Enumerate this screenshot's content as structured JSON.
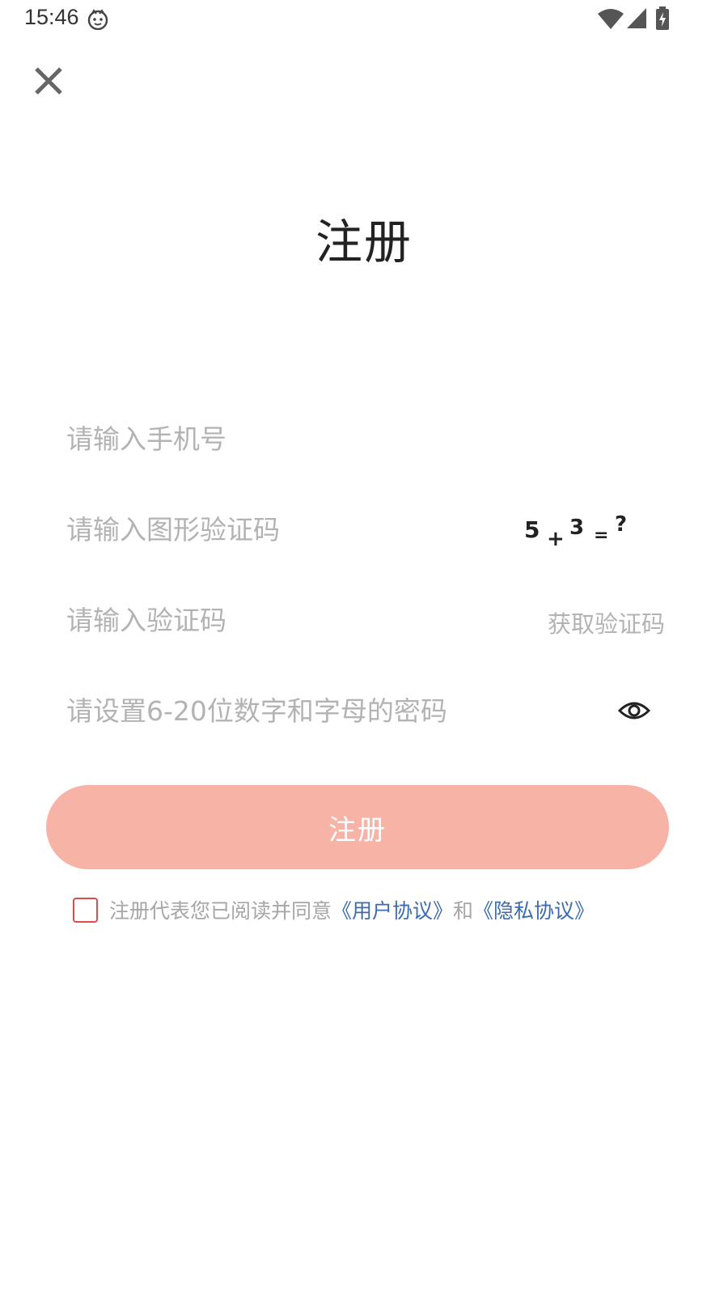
{
  "status_bar": {
    "time": "15:46"
  },
  "header": {
    "close_icon": "close-icon"
  },
  "title": "注册",
  "form": {
    "phone_placeholder": "请输入手机号",
    "captcha_placeholder": "请输入图形验证码",
    "captcha_text": "5 + 3 = ?",
    "code_placeholder": "请输入验证码",
    "get_code_label": "获取验证码",
    "password_placeholder": "请设置6-20位数字和字母的密码",
    "register_label": "注册"
  },
  "agreement": {
    "prefix": "注册代表您已阅读并同意",
    "user_agreement": "《用户协议》",
    "and": "和",
    "privacy_agreement": "《隐私协议》"
  },
  "colors": {
    "button_bg": "#f7b3a5",
    "link": "#3c6bb0",
    "checkbox_border": "#e24a4a",
    "placeholder": "#b3b3b3"
  }
}
